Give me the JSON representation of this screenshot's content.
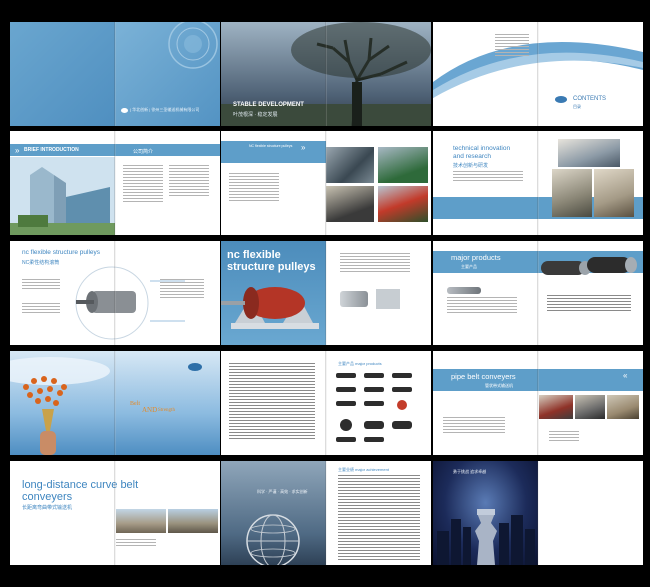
{
  "spreads": {
    "cover": {
      "company_line": "| 华北创新 | 徐州三圣输送机械有限公司"
    },
    "tree": {
      "heading": "STABLE DEVELOPMENT",
      "sub": "叶茂根深 · 稳定发展"
    },
    "contents": {
      "heading": "CONTENTS",
      "sub": "目录"
    },
    "intro": {
      "heading": "BRIEF INTRODUCTION",
      "page_title": "公司简介"
    },
    "pulleys": {
      "heading": "NC flexible structure pulleys"
    },
    "innovation": {
      "heading_line1": "technical innovation",
      "heading_line2": "and research",
      "sub": "技术创新与研发"
    },
    "nc_pulleys": {
      "title": "nc flexible structure pulleys",
      "sub": "NC柔性结构滚筒"
    },
    "nc_big": {
      "line1": "nc flexible",
      "line2": "structure pulleys"
    },
    "major": {
      "heading": "major products",
      "sub": "主要产品"
    },
    "torch": {
      "line1": "Belt",
      "line2": "AND",
      "line3": "Strength"
    },
    "products": {
      "heading": "主要产品 major products"
    },
    "pipe": {
      "heading": "pipe belt conveyers",
      "sub": "管状带式输送机"
    },
    "curve": {
      "line1": "long-distance curve belt",
      "line2": "conveyers",
      "sub": "长距离弯曲带式输送机"
    },
    "globe": {
      "motto": "科学 · 严谨 · 高效 · 求实创新"
    },
    "achieve": {
      "heading": "主要业绩 major achievement"
    },
    "city": {
      "motto": "勇于挑战 追求卓越"
    }
  }
}
